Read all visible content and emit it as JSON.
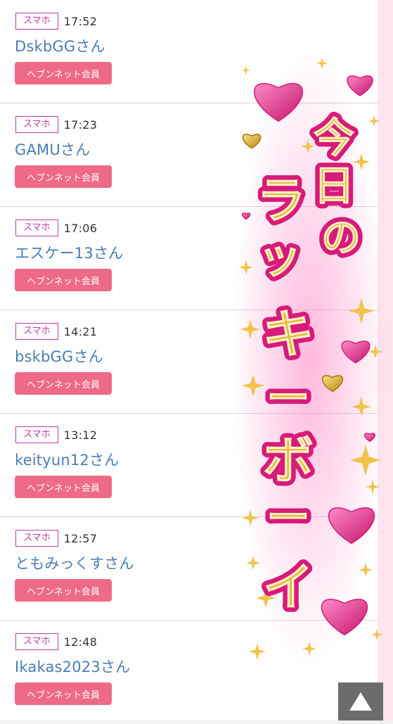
{
  "entries": [
    {
      "device": "スマホ",
      "time": "17:52",
      "name": "DskbGGさん",
      "member_label": "ヘブンネット会員"
    },
    {
      "device": "スマホ",
      "time": "17:23",
      "name": "GAMUさん",
      "member_label": "ヘブンネット会員"
    },
    {
      "device": "スマホ",
      "time": "17:06",
      "name": "エスケー13さん",
      "member_label": "ヘブンネット会員"
    },
    {
      "device": "スマホ",
      "time": "14:21",
      "name": "bskbGGさん",
      "member_label": "ヘブンネット会員"
    },
    {
      "device": "スマホ",
      "time": "13:12",
      "name": "keityun12さん",
      "member_label": "ヘブンネット会員"
    },
    {
      "device": "スマホ",
      "time": "12:57",
      "name": "ともみっくすさん",
      "member_label": "ヘブンネット会員"
    },
    {
      "device": "スマホ",
      "time": "12:48",
      "name": "Ikakas2023さん",
      "member_label": "ヘブンネット会員"
    }
  ],
  "banner": {
    "title_chars": [
      "今",
      "日",
      "の",
      "ラ",
      "ッ",
      "キ",
      "ー",
      "ボ",
      "ー",
      "イ"
    ],
    "text_color": "#e8b53a",
    "outline_color": "#d81b7a",
    "heart_color": "#e52c8a",
    "heart_gold_color": "#d9a82a",
    "sparkle_color": "#f2c24b"
  },
  "scroll_top": {
    "icon": "triangle-up-icon"
  }
}
